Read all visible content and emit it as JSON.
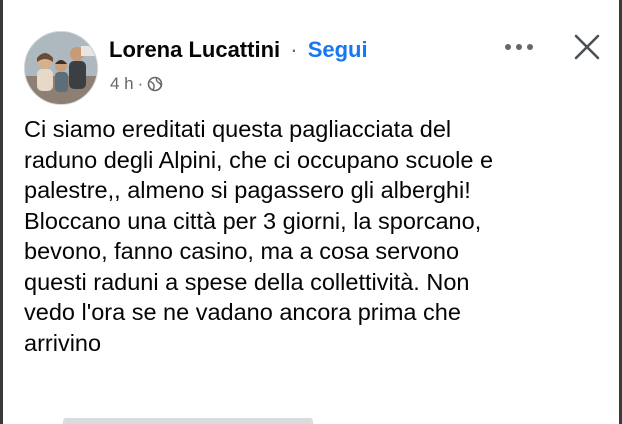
{
  "post": {
    "author": "Lorena Lucattini",
    "separator": "·",
    "follow_label": "Segui",
    "time": "4 h",
    "meta_separator": "·",
    "audience_icon": "globe-icon",
    "more_icon": "more-horizontal-icon",
    "close_icon": "close-icon",
    "text": "Ci siamo ereditati questa pagliacciata del\nraduno degli Alpini, che ci occupano scuole e\npalestre,, almeno si pagassero gli alberghi!\nBloccano una città per 3 giorni, la sporcano,\nbevono, fanno casino, ma a cosa servono\nquesti raduni a spese della collettività. Non\nvedo l'ora se ne vadano ancora prima che\narrivino"
  },
  "colors": {
    "link": "#1877f2",
    "text": "#050505",
    "secondary_text": "#65676b",
    "background": "#ffffff"
  }
}
